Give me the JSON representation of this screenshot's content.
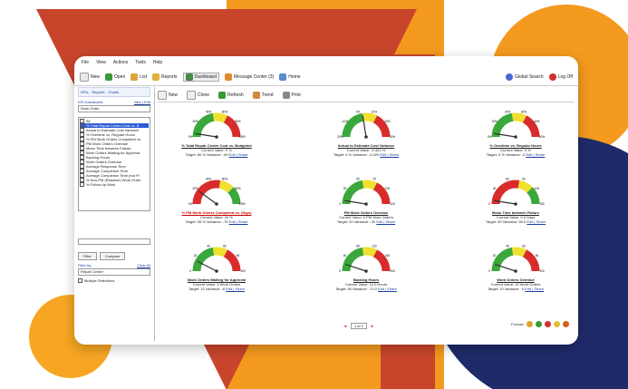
{
  "colors": {
    "accent": "#1a3fa0",
    "red": "#c8452c",
    "orange": "#f39a1f",
    "navy": "#1f2a69"
  },
  "menu": [
    "File",
    "View",
    "Actions",
    "Tools",
    "Help"
  ],
  "toolbar": {
    "new": "New",
    "open": "Open",
    "list": "List",
    "reports": "Reports",
    "dashboard": "Dashboard",
    "message_center": "Message Center (3)",
    "home": "Home",
    "global_search": "Global Search",
    "logoff": "Log Off"
  },
  "left": {
    "tabs": [
      "KPIs",
      "Reports",
      "Charts"
    ],
    "kpi_dashboard_label": "KPI Dashboard:",
    "new_edit": "New | Edit",
    "dashboard_select": "Work Order",
    "list_items": [
      {
        "label": "All",
        "selected": false
      },
      {
        "label": "% Total Repair Center Cost vs. B",
        "selected": true
      },
      {
        "label": "Actual to Estimate Cost Variance",
        "selected": false
      },
      {
        "label": "% Overtime vs. Regular Hours",
        "selected": false
      },
      {
        "label": "% PM Work Orders Completed vs",
        "selected": false
      },
      {
        "label": "PM Work Orders Overdue",
        "selected": false
      },
      {
        "label": "Mean Time between Failure",
        "selected": false
      },
      {
        "label": "Work Orders Waiting for Approval",
        "selected": false
      },
      {
        "label": "Backlog Hours",
        "selected": false
      },
      {
        "label": "Work Orders Overdue",
        "selected": false
      },
      {
        "label": "Average Response Time",
        "selected": false
      },
      {
        "label": "Average Completion Time",
        "selected": false
      },
      {
        "label": "Average Completion Time (not PI",
        "selected": false
      },
      {
        "label": "% Non-PM (Reactive) Work Order",
        "selected": false
      },
      {
        "label": "% Follow-up Work",
        "selected": false
      }
    ],
    "filter_btn": "Filter",
    "compare_btn": "Compare",
    "filter_by": "Filter by:",
    "clear_all": "Clear All",
    "filter_select": "Repair Center",
    "multiple": "Multiple Selections"
  },
  "main_toolbar": {
    "new": "New",
    "clone": "Clone",
    "refresh": "Refresh",
    "trend": "Trend",
    "print": "Print"
  },
  "gauges": [
    {
      "title": "% Total Repair Center Cost vs. Budgeted",
      "current": "Current Value: 0 %",
      "target": "Target: 60 % Variance: -60",
      "links": "Edit | Share",
      "value": 0.05,
      "alert": false,
      "scheme": "grn-yel-red",
      "labels": [
        "0%",
        "20%",
        "40%",
        "60%",
        "80%",
        "100%"
      ]
    },
    {
      "title": "Actual to Estimate Cost Variance",
      "current": "Current Value: -0.420 %",
      "target": "Target: 0 % Variance: -0.420",
      "links": "Edit | Share",
      "value": 0.45,
      "alert": false,
      "scheme": "grn-yel-red",
      "labels": [
        "-20%",
        "-10%",
        "0%",
        "10%",
        "20%",
        "30%"
      ]
    },
    {
      "title": "% Overtime vs. Regular Hours",
      "current": "Current Value: 0 %",
      "target": "Target: 0 % Variance: -0",
      "links": "Edit | Share",
      "value": 0.05,
      "alert": false,
      "scheme": "grn-yel-red",
      "labels": [
        "0%",
        "10%",
        "20%",
        "30%",
        "40%",
        "50%"
      ]
    },
    {
      "title": "% PM Work Orders Completed vs. (Sign)",
      "current": "Current Value: 20 %",
      "target": "Target: 95 % Variance: -75",
      "links": "Edit | Share",
      "value": 0.2,
      "alert": true,
      "scheme": "red-yel-grn",
      "labels": [
        "0%",
        "20%",
        "40%",
        "60%",
        "80%",
        "100%"
      ]
    },
    {
      "title": "PM Work Orders Overdue",
      "current": "Current Value: 0 PM Work Orders",
      "target": "Target: 20 Variance: -20",
      "links": "Edit | Share",
      "value": 0.05,
      "alert": false,
      "scheme": "grn-yel-red",
      "labels": [
        "0",
        "25",
        "50",
        "75",
        "100",
        "125"
      ]
    },
    {
      "title": "Mean Time between Failure",
      "current": "Current Value: 0.0 Days",
      "target": "Target: 90 Variance: 90.0",
      "links": "Edit | Share",
      "value": 0.05,
      "alert": false,
      "scheme": "red-yel-grn",
      "labels": [
        "0",
        "30",
        "60",
        "90",
        "120",
        "150"
      ]
    },
    {
      "title": "Work Orders Waiting for Approval",
      "current": "Current Value: 4 Work Orders",
      "target": "Target: 10 Variance: -6",
      "links": "Edit | Share",
      "value": 0.15,
      "alert": false,
      "scheme": "grn-yel-red",
      "labels": [
        "0",
        "20",
        "40",
        "60",
        "80",
        "100"
      ]
    },
    {
      "title": "Backlog Hours",
      "current": "Current Value: 12.0 Hours",
      "target": "Target: 80 Variance: -70.0",
      "links": "Edit | Share",
      "value": 0.1,
      "alert": false,
      "scheme": "grn-yel-red",
      "labels": [
        "0",
        "40",
        "80",
        "120",
        "160",
        "200"
      ]
    },
    {
      "title": "Work Orders Overdue",
      "current": "Current Value: 10 Work Orders",
      "target": "Target: 10 Variance: -0",
      "links": "Edit | Share",
      "value": 0.1,
      "alert": false,
      "scheme": "grn-yel-red",
      "labels": [
        "0",
        "20",
        "40",
        "60",
        "80",
        "100"
      ]
    }
  ],
  "pager": {
    "text": "1 of 2",
    "prev": "◄",
    "next": "►"
  },
  "format_label": "Format:"
}
